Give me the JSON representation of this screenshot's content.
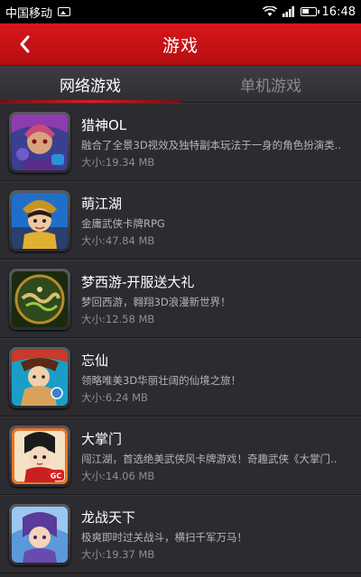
{
  "status_bar": {
    "carrier": "中国移动",
    "time": "16:48"
  },
  "header": {
    "title": "游戏"
  },
  "tabs": [
    {
      "label": "网络游戏",
      "active": true
    },
    {
      "label": "单机游戏",
      "active": false
    }
  ],
  "games": [
    {
      "name": "猎神OL",
      "desc": "融合了全景3D视效及独特副本玩法于一身的角色扮演类..",
      "size": "大小:19.34 MB",
      "icon": "hunter-god-icon"
    },
    {
      "name": "萌江湖",
      "desc": "金庸武侠卡牌RPG",
      "size": "大小:47.84 MB",
      "icon": "meng-jianghu-icon"
    },
    {
      "name": "梦西游-开服送大礼",
      "desc": "梦回西游，翱翔3D浪漫新世界！",
      "size": "大小:12.58 MB",
      "icon": "dream-journey-icon"
    },
    {
      "name": "忘仙",
      "desc": "领略唯美3D华丽壮阔的仙境之旅！",
      "size": "大小:6.24 MB",
      "icon": "wangxian-icon"
    },
    {
      "name": "大掌门",
      "desc": "闯江湖，首选绝美武侠风卡牌游戏！奇趣武侠《大掌门..",
      "size": "大小:14.06 MB",
      "icon": "da-zhangmen-icon"
    },
    {
      "name": "龙战天下",
      "desc": "极爽即时过关战斗，横扫千军万马！",
      "size": "大小:19.37 MB",
      "icon": "dragon-war-icon"
    }
  ],
  "colors": {
    "title_bar": "#d9161b",
    "tab_indicator": "#e3191e",
    "background": "#2c2b30"
  }
}
